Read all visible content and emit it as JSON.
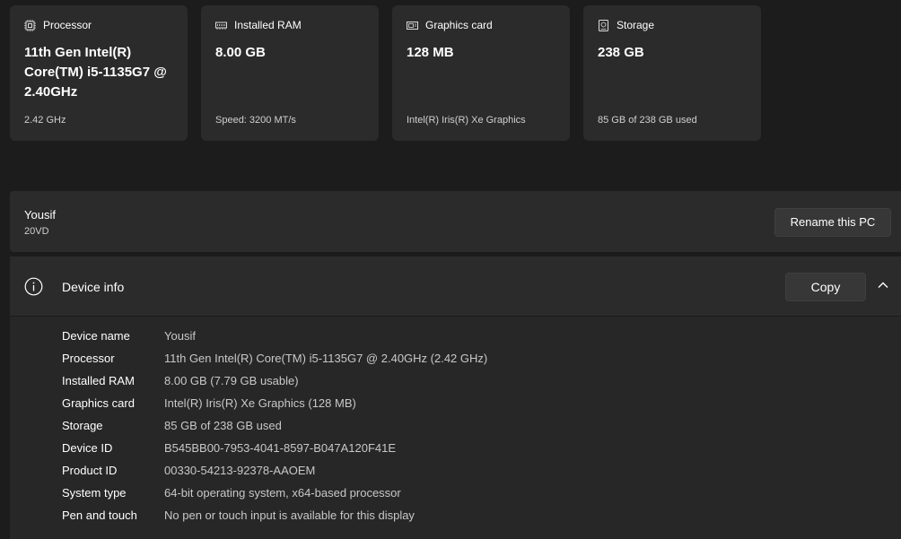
{
  "cards": [
    {
      "id": "processor",
      "icon": "processor-icon",
      "label": "Processor",
      "value": "11th Gen Intel(R) Core(TM) i5-1135G7 @ 2.40GHz",
      "sub": "2.42 GHz"
    },
    {
      "id": "ram",
      "icon": "memory-icon",
      "label": "Installed RAM",
      "value": "8.00 GB",
      "sub": "Speed: 3200 MT/s"
    },
    {
      "id": "graphics",
      "icon": "graphics-card-icon",
      "label": "Graphics card",
      "value": "128 MB",
      "sub": "Intel(R) Iris(R) Xe Graphics"
    },
    {
      "id": "storage",
      "icon": "storage-icon",
      "label": "Storage",
      "value": "238 GB",
      "sub": "85 GB of 238 GB used"
    }
  ],
  "pc": {
    "name": "Yousif",
    "model": "20VD",
    "rename_label": "Rename this PC"
  },
  "device_info": {
    "title": "Device info",
    "copy_label": "Copy",
    "specs": [
      {
        "label": "Device name",
        "value": "Yousif"
      },
      {
        "label": "Processor",
        "value": "11th Gen Intel(R) Core(TM) i5-1135G7 @ 2.40GHz (2.42 GHz)"
      },
      {
        "label": "Installed RAM",
        "value": "8.00 GB (7.79 GB usable)"
      },
      {
        "label": "Graphics card",
        "value": "Intel(R) Iris(R) Xe Graphics (128 MB)"
      },
      {
        "label": "Storage",
        "value": "85 GB of 238 GB used"
      },
      {
        "label": "Device ID",
        "value": "B545BB00-7953-4041-8597-B047A120F41E"
      },
      {
        "label": "Product ID",
        "value": "00330-54213-92378-AAOEM"
      },
      {
        "label": "System type",
        "value": "64-bit operating system, x64-based processor"
      },
      {
        "label": "Pen and touch",
        "value": "No pen or touch input is available for this display"
      }
    ]
  }
}
